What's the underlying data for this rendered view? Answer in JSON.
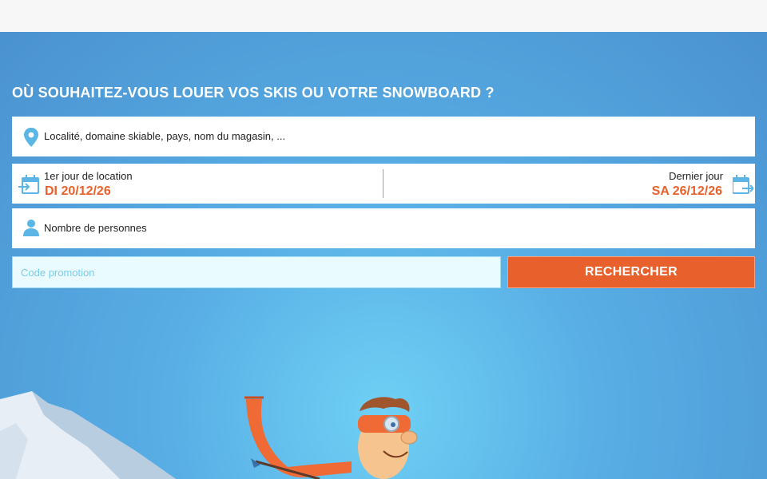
{
  "search": {
    "headline": "OÙ SOUHAITEZ-VOUS LOUER VOS SKIS OU VOTRE SNOWBOARD ?",
    "location_placeholder": "Localité, domaine skiable, pays, nom du magasin, ...",
    "start_label": "1er jour de location",
    "start_value": "DI 20/12/26",
    "end_label": "Dernier jour",
    "end_value": "SA 26/12/26",
    "persons_label": "Nombre de personnes",
    "promo_placeholder": "Code promotion",
    "search_button": "RECHERCHER"
  },
  "icons": {
    "location": "map-pin-icon",
    "start_date": "calendar-start-icon",
    "end_date": "calendar-end-icon",
    "persons": "person-icon"
  },
  "colors": {
    "accent": "#e8612d",
    "icon": "#5bb6e6",
    "sky": "#58aee5"
  }
}
